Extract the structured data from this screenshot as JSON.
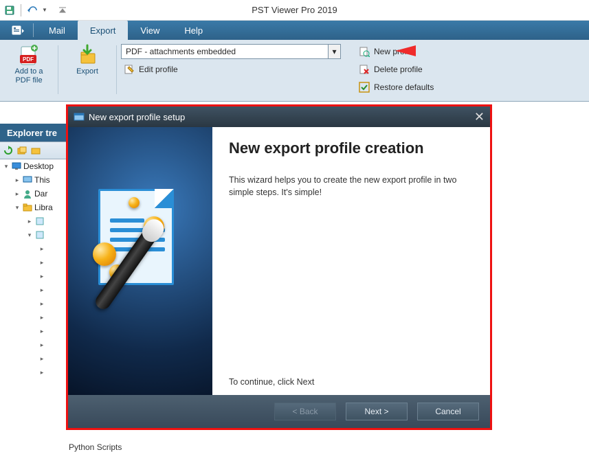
{
  "titlebar": {
    "app_title": "PST Viewer Pro 2019"
  },
  "menubar": {
    "items": [
      "Mail",
      "Export",
      "View",
      "Help"
    ],
    "active_index": 1
  },
  "ribbon": {
    "add_pdf_label": "Add to a PDF file",
    "export_label": "Export",
    "profile_selected": "PDF - attachments embedded",
    "edit_profile": "Edit profile",
    "new_profile": "New profile",
    "delete_profile": "Delete profile",
    "restore_defaults": "Restore defaults"
  },
  "explorer": {
    "header": "Explorer tre",
    "tree": {
      "root": "Desktop",
      "items": [
        "This",
        "Dar",
        "Libra"
      ]
    }
  },
  "dialog": {
    "title": "New export profile setup",
    "heading": "New export profile creation",
    "body": "This wizard helps you to create the new export profile in two simple steps. It's simple!",
    "continue": "To continue, click Next",
    "back": "< Back",
    "next": "Next >",
    "cancel": "Cancel"
  },
  "footer_item": "Python Scripts"
}
